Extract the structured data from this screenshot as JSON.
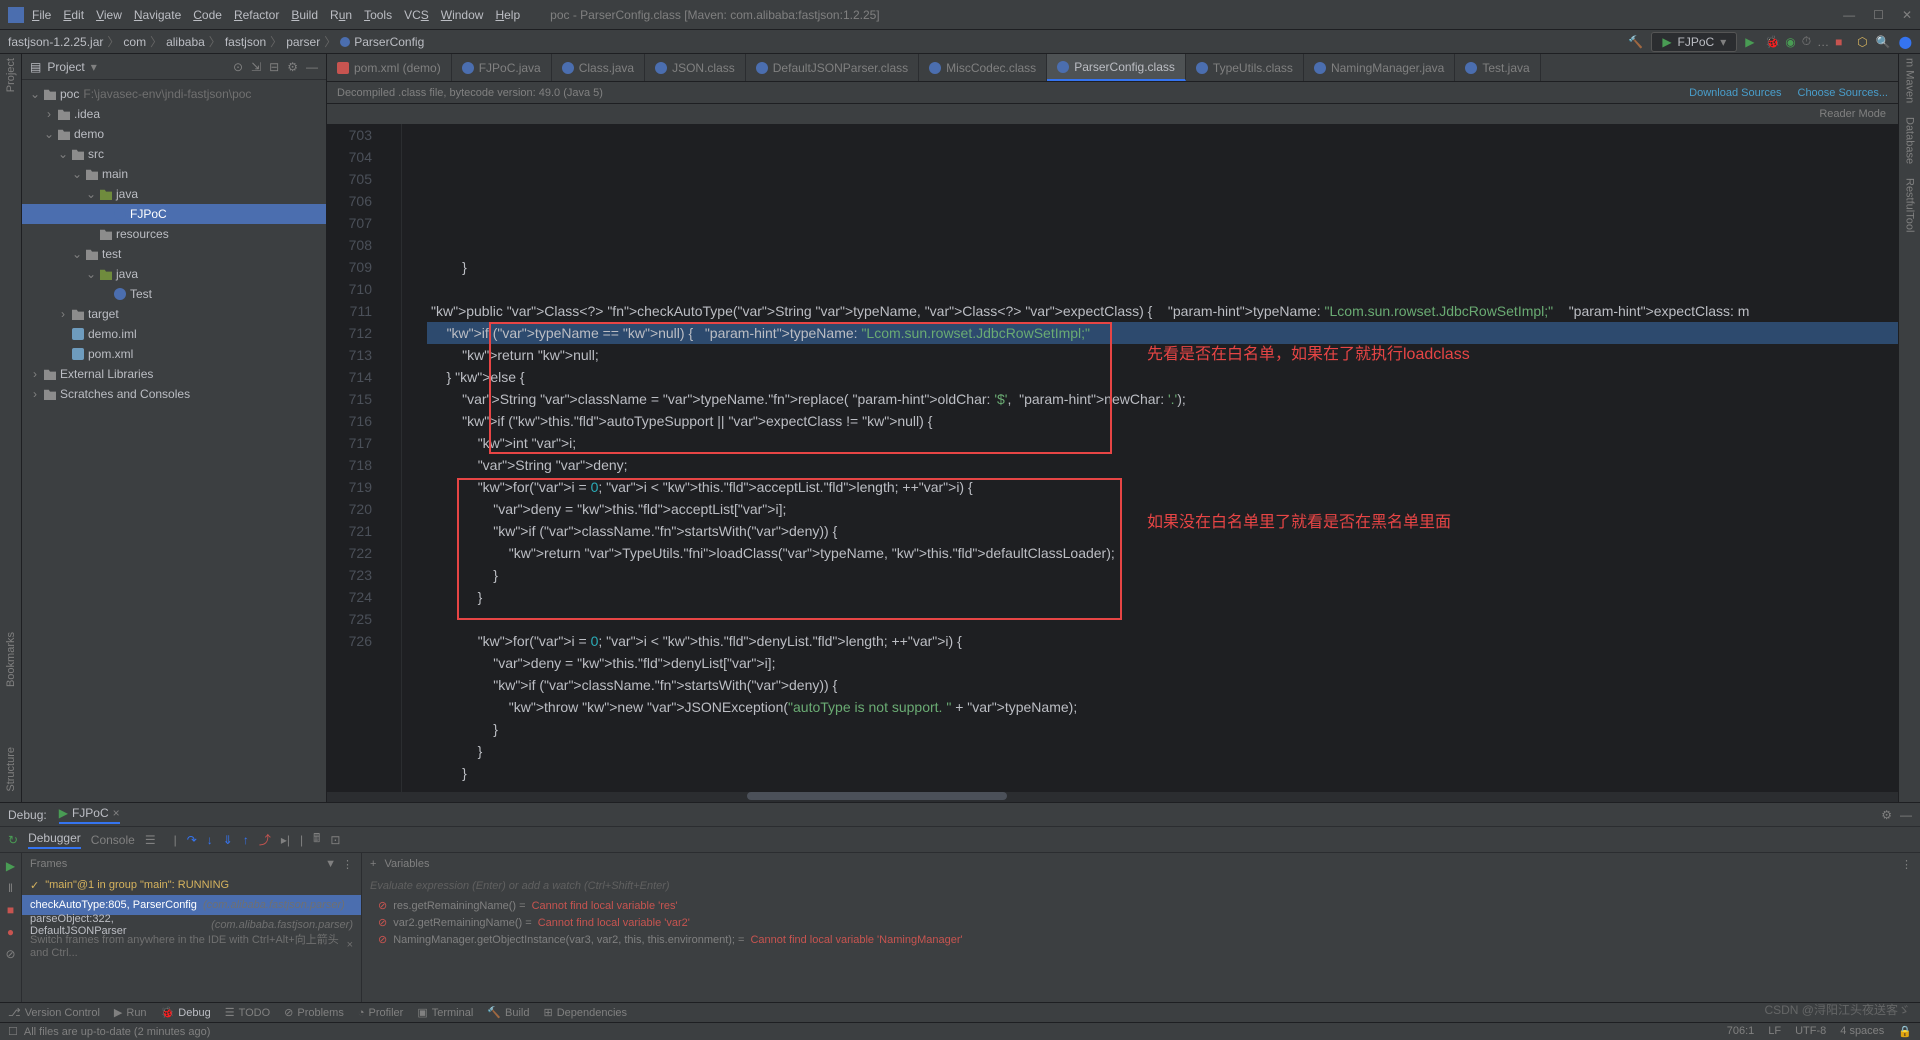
{
  "title": "poc - ParserConfig.class [Maven: com.alibaba:fastjson:1.2.25]",
  "menu": [
    "File",
    "Edit",
    "View",
    "Navigate",
    "Code",
    "Refactor",
    "Build",
    "Run",
    "Tools",
    "VCS",
    "Window",
    "Help"
  ],
  "breadcrumbs": [
    "fastjson-1.2.25.jar",
    "com",
    "alibaba",
    "fastjson",
    "parser",
    "ParserConfig"
  ],
  "run_config": "FJPoC",
  "project_panel": {
    "title": "Project",
    "tree": [
      {
        "d": 0,
        "tw": "v",
        "icon": "folder",
        "label": "poc",
        "dim": "F:\\javasec-env\\jndi-fastjson\\poc"
      },
      {
        "d": 1,
        "tw": ">",
        "icon": "folder",
        "label": ".idea"
      },
      {
        "d": 1,
        "tw": "v",
        "icon": "folder",
        "label": "demo"
      },
      {
        "d": 2,
        "tw": "v",
        "icon": "folder",
        "label": "src"
      },
      {
        "d": 3,
        "tw": "v",
        "icon": "folder",
        "label": "main"
      },
      {
        "d": 4,
        "tw": "v",
        "icon": "folder pkg",
        "label": "java"
      },
      {
        "d": 5,
        "tw": "",
        "icon": "class",
        "label": "FJPoC",
        "sel": true
      },
      {
        "d": 4,
        "tw": "",
        "icon": "folder",
        "label": "resources"
      },
      {
        "d": 3,
        "tw": "v",
        "icon": "folder",
        "label": "test"
      },
      {
        "d": 4,
        "tw": "v",
        "icon": "folder pkg",
        "label": "java"
      },
      {
        "d": 5,
        "tw": "",
        "icon": "class",
        "label": "Test"
      },
      {
        "d": 2,
        "tw": ">",
        "icon": "folder",
        "label": "target"
      },
      {
        "d": 2,
        "tw": "",
        "icon": "file",
        "label": "demo.iml"
      },
      {
        "d": 2,
        "tw": "",
        "icon": "file",
        "label": "pom.xml"
      },
      {
        "d": 0,
        "tw": ">",
        "icon": "folder",
        "label": "External Libraries"
      },
      {
        "d": 0,
        "tw": ">",
        "icon": "folder",
        "label": "Scratches and Consoles"
      }
    ]
  },
  "tabs": [
    {
      "icon": "xml",
      "label": "pom.xml (demo)"
    },
    {
      "icon": "cls",
      "label": "FJPoC.java"
    },
    {
      "icon": "cls",
      "label": "Class.java"
    },
    {
      "icon": "cls",
      "label": "JSON.class"
    },
    {
      "icon": "cls",
      "label": "DefaultJSONParser.class"
    },
    {
      "icon": "cls",
      "label": "MiscCodec.class"
    },
    {
      "icon": "cls",
      "label": "ParserConfig.class",
      "active": true
    },
    {
      "icon": "cls",
      "label": "TypeUtils.class"
    },
    {
      "icon": "cls",
      "label": "NamingManager.java"
    },
    {
      "icon": "cls",
      "label": "Test.java"
    }
  ],
  "info_bar": {
    "text": "Decompiled .class file, bytecode version: 49.0 (Java 5)",
    "links": [
      "Download Sources",
      "Choose Sources..."
    ]
  },
  "reader_mode": "Reader Mode",
  "line_start": 703,
  "code": [
    "        }",
    "",
    "public Class<?> checkAutoType(String typeName, Class<?> expectClass) {    typeName: \"Lcom.sun.rowset.JdbcRowSetImpl;\"    expectClass: m",
    "    if (typeName == null) {   typeName: \"Lcom.sun.rowset.JdbcRowSetImpl;\"",
    "        return null;",
    "    } else {",
    "        String className = typeName.replace( oldChar: '$',  newChar: '.');",
    "        if (this.autoTypeSupport || expectClass != null) {",
    "            int i;",
    "            String deny;",
    "            for(i = 0; i < this.acceptList.length; ++i) {",
    "                deny = this.acceptList[i];",
    "                if (className.startsWith(deny)) {",
    "                    return TypeUtils.loadClass(typeName, this.defaultClassLoader);",
    "                }",
    "            }",
    "",
    "            for(i = 0; i < this.denyList.length; ++i) {",
    "                deny = this.denyList[i];",
    "                if (className.startsWith(deny)) {",
    "                    throw new JSONException(\"autoType is not support. \" + typeName);",
    "                }",
    "            }",
    "        }"
  ],
  "annotations": {
    "box1_text": "先看是否在白名单，如果在了就执行loadclass",
    "box2_text": "如果没在白名单里了就看是否在黑名单里面"
  },
  "debug": {
    "label": "Debug:",
    "tab": "FJPoC",
    "subtabs": [
      "Debugger",
      "Console"
    ],
    "frames_label": "Frames",
    "vars_label": "Variables",
    "eval_placeholder": "Evaluate expression (Enter) or add a watch (Ctrl+Shift+Enter)",
    "thread": "\"main\"@1 in group \"main\": RUNNING",
    "frames": [
      {
        "m": "checkAutoType:805, ParserConfig",
        "dim": "(com.alibaba.fastjson.parser)",
        "sel": true
      },
      {
        "m": "parseObject:322, DefaultJSONParser",
        "dim": "(com.alibaba.fastjson.parser)"
      }
    ],
    "frames_hint": "Switch frames from anywhere in the IDE with Ctrl+Alt+向上箭头 and Ctrl...",
    "vars_errors": [
      {
        "name": "res.getRemainingName()",
        "msg": "Cannot find local variable 'res'"
      },
      {
        "name": "var2.getRemainingName()",
        "msg": "Cannot find local variable 'var2'"
      },
      {
        "name": "NamingManager.getObjectInstance(var3, var2, this, this.environment);",
        "msg": "Cannot find local variable 'NamingManager'"
      }
    ]
  },
  "bottom_bar": [
    "Version Control",
    "Run",
    "Debug",
    "TODO",
    "Problems",
    "Profiler",
    "Terminal",
    "Build",
    "Dependencies"
  ],
  "status": {
    "text": "All files are up-to-date (2 minutes ago)",
    "right": [
      "706:1",
      "LF",
      "UTF-8",
      "4 spaces"
    ]
  },
  "watermark": "CSDN @浔阳江头夜送客ゞ"
}
